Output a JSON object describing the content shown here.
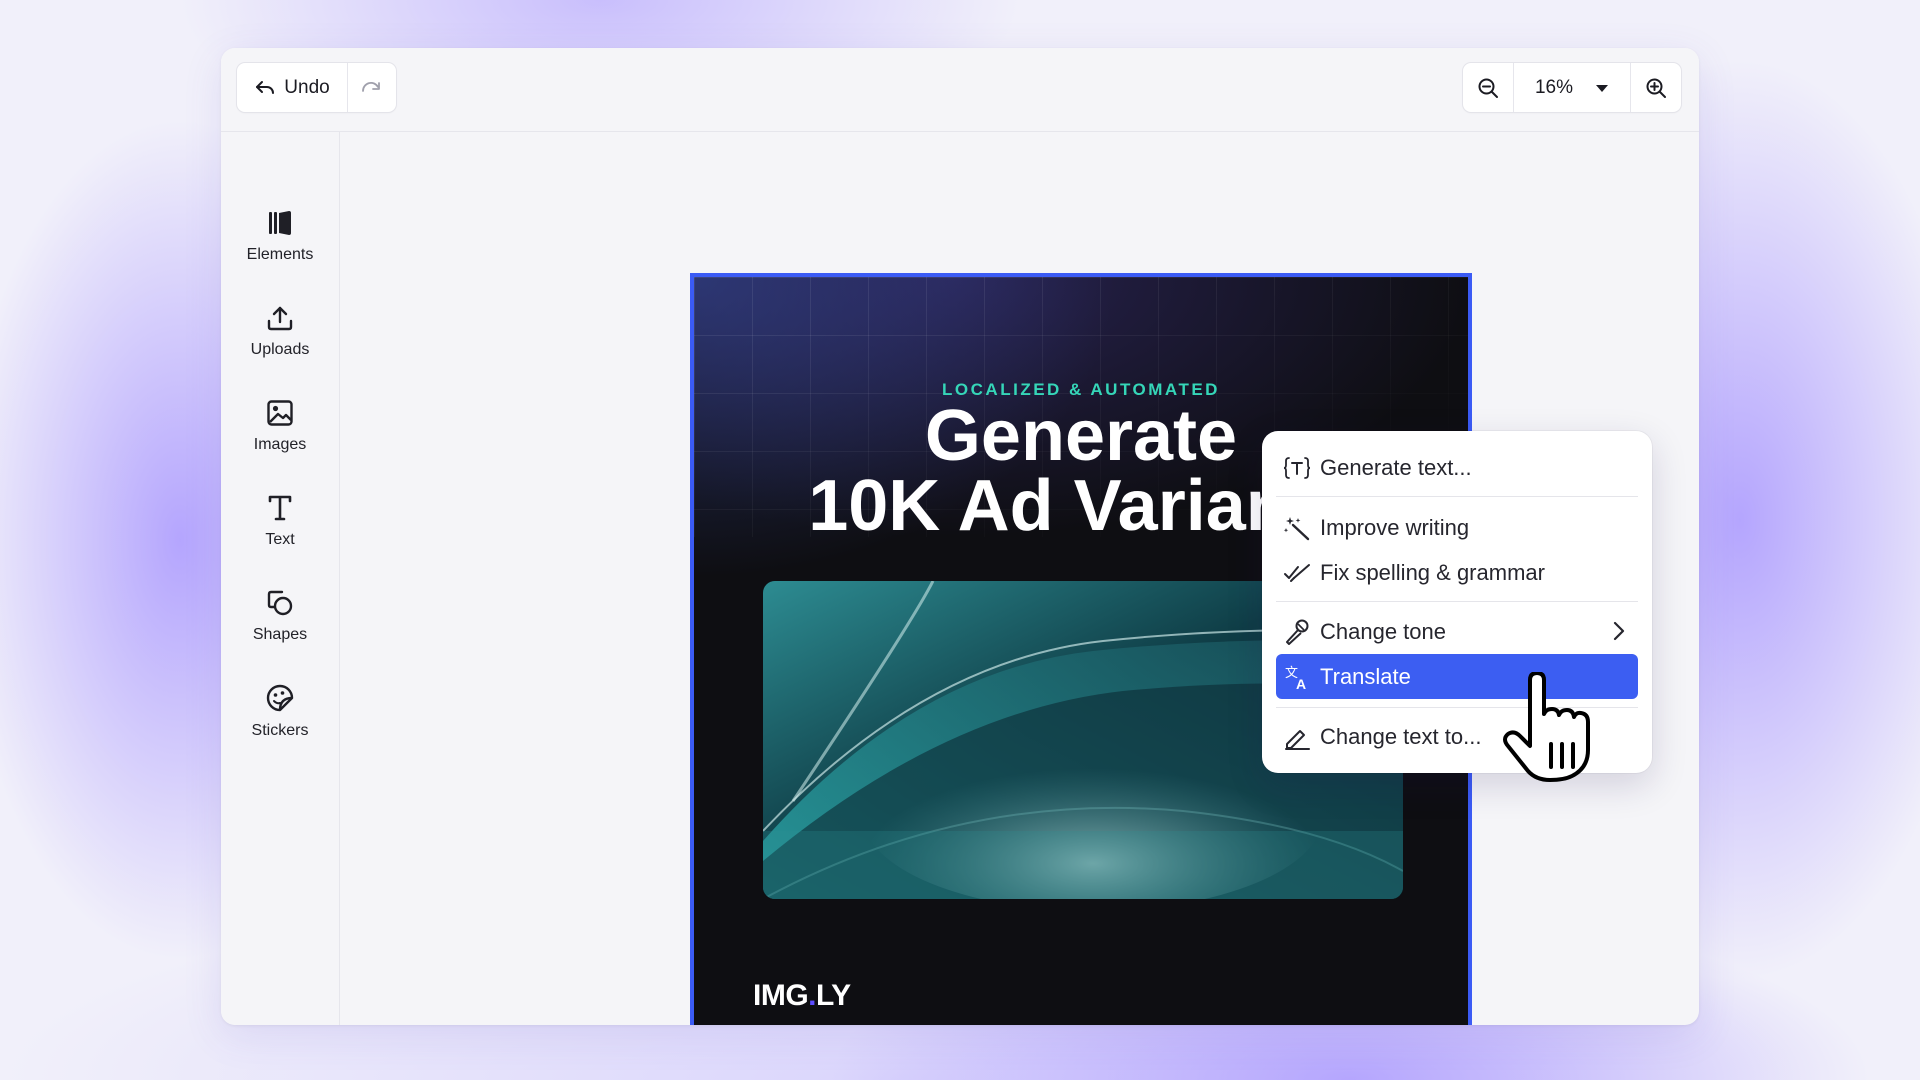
{
  "toolbar": {
    "undo_label": "Undo",
    "undo_icon": "undo-arrow-icon",
    "redo_icon": "redo-arrow-icon",
    "zoom_out_icon": "zoom-out-icon",
    "zoom_in_icon": "zoom-in-icon",
    "zoom_value": "16%",
    "zoom_dropdown_icon": "caret-down-icon"
  },
  "sidebar": {
    "items": [
      {
        "label": "Elements",
        "icon": "elements-icon"
      },
      {
        "label": "Uploads",
        "icon": "upload-icon"
      },
      {
        "label": "Images",
        "icon": "image-icon"
      },
      {
        "label": "Text",
        "icon": "text-icon"
      },
      {
        "label": "Shapes",
        "icon": "shapes-icon"
      },
      {
        "label": "Stickers",
        "icon": "sticker-icon"
      }
    ]
  },
  "design": {
    "eyebrow": "LOCALIZED & AUTOMATED",
    "headline_line1": "Generate",
    "headline_line2": "10K Ad Variants",
    "logo_part1": "IMG",
    "logo_dot": ".",
    "logo_part2": "LY",
    "selection_color": "#3b5bf5",
    "eyebrow_color": "#35d6b8"
  },
  "context_menu": {
    "items": [
      {
        "label": "Generate text...",
        "icon": "curly-text-icon"
      },
      {
        "label": "Improve writing",
        "icon": "magic-wand-icon"
      },
      {
        "label": "Fix spelling & grammar",
        "icon": "double-check-icon"
      },
      {
        "label": "Change tone",
        "icon": "microphone-icon",
        "has_submenu": true
      },
      {
        "label": "Translate",
        "icon": "translate-icon",
        "active": true
      },
      {
        "label": "Change text to...",
        "icon": "pencil-icon"
      }
    ],
    "active_color": "#3c5ef2"
  }
}
